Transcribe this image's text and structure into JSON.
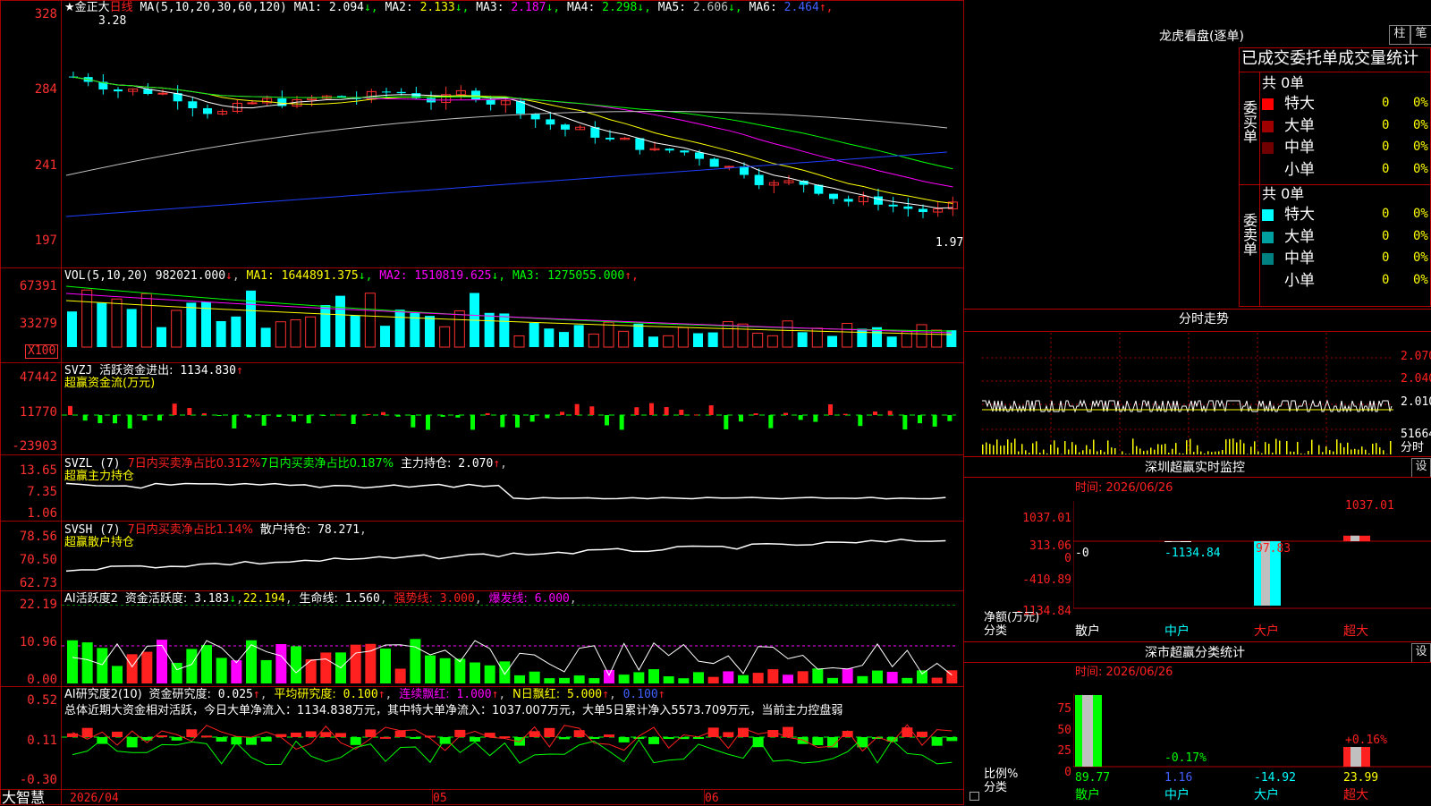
{
  "stock": {
    "name": "★金正大",
    "period": "日线"
  },
  "main_panel": {
    "ma_header": "MA(5,10,20,30,60,120)",
    "ma": [
      {
        "label": "MA1:",
        "value": "2.094",
        "arrow": "↓",
        "color": "#ffffff"
      },
      {
        "label": "MA2:",
        "value": "2.133",
        "arrow": "↓",
        "color": "#ffff00"
      },
      {
        "label": "MA3:",
        "value": "2.187",
        "arrow": "↓",
        "color": "#ff00ff"
      },
      {
        "label": "MA4:",
        "value": "2.298",
        "arrow": "↓",
        "color": "#00ff00"
      },
      {
        "label": "MA5:",
        "value": "2.606",
        "arrow": "↓",
        "color": "#c0c0c0"
      },
      {
        "label": "MA6:",
        "value": "2.464",
        "arrow": "↑",
        "color": "#4060ff"
      }
    ],
    "y_labels": [
      "328",
      "284",
      "241",
      "197"
    ],
    "high_mark": "3.28",
    "low_mark": "1.97"
  },
  "vol_panel": {
    "header": "VOL(5,10,20)",
    "value": "982021.000",
    "items": [
      {
        "label": "MA1:",
        "value": "1644891.375",
        "arrow": "↓",
        "color": "#ffff00"
      },
      {
        "label": "MA2:",
        "value": "1510819.625",
        "arrow": "↓",
        "color": "#ff00ff"
      },
      {
        "label": "MA3:",
        "value": "1275055.000",
        "arrow": "↑",
        "color": "#00ff00"
      }
    ],
    "y_labels": [
      "67391",
      "33279"
    ],
    "unit": "X100"
  },
  "svzj": {
    "name": "SVZJ",
    "label": "活跃资金进出:",
    "value": "1134.830",
    "arrow": "↑",
    "sub": "超赢资金流(万元)",
    "y_labels": [
      "47442",
      "11770",
      "-23903"
    ]
  },
  "svzl": {
    "name": "SVZL (7)",
    "t1": "7日内买卖净占比0.312%",
    "t2": "7日内买卖净占比0.187%",
    "label": "主力持仓:",
    "value": "2.070",
    "arrow": "↑",
    "sub": "超赢主力持仓",
    "y_labels": [
      "13.65",
      "7.35",
      "1.06"
    ]
  },
  "svsh": {
    "name": "SVSH (7)",
    "t1": "7日内买卖净占比1.14%",
    "label": "散户持仓:",
    "value": "78.271",
    "sub": "超赢散户持仓",
    "y_labels": [
      "78.56",
      "70.50",
      "62.73"
    ]
  },
  "ai1": {
    "name": "AI活跃度2",
    "label": "资金活跃度:",
    "value": "3.183",
    "arrow": "↓",
    "v2": "22.194",
    "l3": "生命线:",
    "v3": "1.560",
    "l4": "强势线:",
    "v4": "3.000",
    "l5": "爆发线:",
    "v5": "6.000",
    "y_labels": [
      "22.19",
      "10.96",
      "0.00"
    ]
  },
  "ai2": {
    "name": "AI研究度2(10)",
    "label": "资金研究度:",
    "value": "0.025",
    "arrow": "↑",
    "l2": "平均研究度:",
    "v2": "0.100",
    "l3": "连续飘红:",
    "v3": "1.000",
    "l4": "N日飘红:",
    "v4": "5.000",
    "v5": "0.100",
    "summary": "总体近期大资金相对活跃，今日大单净流入：1134.838万元，其中特大单净流入：1037.007万元，大单5日累计净入5573.709万元，当前主力控盘弱",
    "y_labels": [
      "0.52",
      "0.11",
      "-0.30"
    ]
  },
  "bottom": {
    "brand": "大智慧",
    "date1": "2026/04",
    "date2": "05",
    "date3": "06"
  },
  "right": {
    "title": "龙虎看盘(逐单)",
    "btn1": "柱",
    "btn2": "笔",
    "stats_title": "已成交委托单成交量统计",
    "buy": {
      "side": "委买单",
      "total": "共 0单",
      "rows": [
        {
          "name": "特大",
          "v": "0",
          "p": "0%",
          "color": "#ff0000"
        },
        {
          "name": "大单",
          "v": "0",
          "p": "0%",
          "color": "#a00000"
        },
        {
          "name": "中单",
          "v": "0",
          "p": "0%",
          "color": "#700000"
        },
        {
          "name": "小单",
          "v": "0",
          "p": "0%",
          "color": "#000000"
        }
      ]
    },
    "sell": {
      "side": "委卖单",
      "total": "共 0单",
      "rows": [
        {
          "name": "特大",
          "v": "0",
          "p": "0%",
          "color": "#00ffff"
        },
        {
          "name": "大单",
          "v": "0",
          "p": "0%",
          "color": "#00a0a0"
        },
        {
          "name": "中单",
          "v": "0",
          "p": "0%",
          "color": "#008080"
        },
        {
          "name": "小单",
          "v": "0",
          "p": "0%",
          "color": "#000000"
        }
      ]
    },
    "intraday": {
      "title": "分时走势",
      "y": [
        "2.070",
        "2.040",
        "2.010",
        "51664"
      ],
      "unit": "分时"
    },
    "sz_monitor": {
      "title": "深圳超赢实时监控",
      "set": "设",
      "time": "时间: 2026/06/26",
      "y": [
        "1037.01",
        "313.06",
        "0",
        "-410.89",
        "-1134.84"
      ],
      "bar_labels": [
        "-0",
        "-1134.84",
        "97.83",
        "1037.01"
      ],
      "net_label": "净额(万元)",
      "cat_label": "分类",
      "cats": [
        "散户",
        "中户",
        "大户",
        "超大"
      ]
    },
    "sz_class": {
      "title": "深市超赢分类统计",
      "set": "设",
      "time": "时间: 2026/06/26",
      "y": [
        "75",
        "50",
        "25",
        "0"
      ],
      "top_labels": [
        "-0.17%",
        "+0.16%"
      ],
      "ratio_label": "比例%",
      "cat_label": "分类",
      "vals": [
        "89.77",
        "1.16",
        "-14.92",
        "23.99"
      ],
      "cats": [
        "散户",
        "中户",
        "大户",
        "超大"
      ]
    }
  }
}
